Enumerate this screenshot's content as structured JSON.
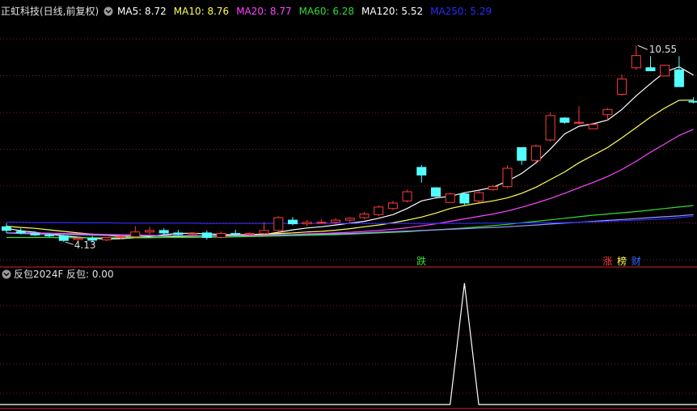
{
  "header": {
    "stock_title": "正虹科技(日线,前复权)",
    "indicator_title": "反包2024F",
    "indicator_value": "反包: 0.00"
  },
  "colors": {
    "background": "#000000",
    "grid": "#8b1a1a",
    "up_candle": "#ff3c3c",
    "down_candle": "#54ffff",
    "axis_line": "#8b1a1a"
  },
  "chart_data": [
    {
      "type": "candlestick",
      "title": "正虹科技(日线,前复权)",
      "ylim": [
        3.6,
        11.3
      ],
      "price_labels": {
        "high": "10.55",
        "low": "4.13"
      },
      "ma_legend": [
        {
          "name": "MA5",
          "label": "MA5: 8.72",
          "color": "#ffffff"
        },
        {
          "name": "MA10",
          "label": "MA10: 8.76",
          "color": "#ffff55"
        },
        {
          "name": "MA20",
          "label": "MA20: 8.77",
          "color": "#ff44ff"
        },
        {
          "name": "MA60",
          "label": "MA60: 6.28",
          "color": "#33dd33"
        },
        {
          "name": "MA120",
          "label": "MA120: 5.52",
          "color": "#ffffff"
        },
        {
          "name": "MA250",
          "label": "MA250: 5.29",
          "color": "#2a2aff"
        }
      ],
      "ohlc": [
        [
          4.6,
          4.72,
          4.4,
          4.48
        ],
        [
          4.45,
          4.55,
          4.35,
          4.4
        ],
        [
          4.38,
          4.45,
          4.3,
          4.33
        ],
        [
          4.33,
          4.4,
          4.26,
          4.3
        ],
        [
          4.3,
          4.33,
          4.1,
          4.15
        ],
        [
          4.18,
          4.26,
          4.13,
          4.22
        ],
        [
          4.22,
          4.3,
          4.13,
          4.16
        ],
        [
          4.17,
          4.27,
          4.13,
          4.25
        ],
        [
          4.25,
          4.35,
          4.2,
          4.28
        ],
        [
          4.28,
          4.62,
          4.25,
          4.43
        ],
        [
          4.43,
          4.6,
          4.35,
          4.48
        ],
        [
          4.48,
          4.55,
          4.35,
          4.4
        ],
        [
          4.4,
          4.5,
          4.32,
          4.35
        ],
        [
          4.35,
          4.42,
          4.3,
          4.38
        ],
        [
          4.4,
          4.48,
          4.18,
          4.25
        ],
        [
          4.25,
          4.45,
          4.22,
          4.38
        ],
        [
          4.38,
          4.5,
          4.3,
          4.35
        ],
        [
          4.35,
          4.42,
          4.3,
          4.38
        ],
        [
          4.38,
          4.75,
          4.35,
          4.48
        ],
        [
          4.48,
          4.95,
          4.45,
          4.9
        ],
        [
          4.82,
          4.92,
          4.65,
          4.7
        ],
        [
          4.7,
          4.82,
          4.62,
          4.75
        ],
        [
          4.75,
          4.85,
          4.7,
          4.75
        ],
        [
          4.75,
          4.88,
          4.7,
          4.82
        ],
        [
          4.82,
          4.92,
          4.75,
          4.88
        ],
        [
          4.9,
          5.08,
          4.85,
          5.02
        ],
        [
          5.0,
          5.3,
          4.95,
          5.25
        ],
        [
          5.2,
          5.45,
          5.15,
          5.38
        ],
        [
          5.45,
          5.82,
          5.4,
          5.75
        ],
        [
          6.55,
          6.63,
          6.05,
          6.3
        ],
        [
          5.88,
          5.9,
          5.57,
          5.6
        ],
        [
          5.4,
          5.72,
          5.4,
          5.68
        ],
        [
          5.68,
          5.71,
          5.3,
          5.38
        ],
        [
          5.45,
          5.78,
          5.4,
          5.72
        ],
        [
          5.82,
          5.98,
          5.78,
          5.92
        ],
        [
          5.92,
          6.62,
          5.88,
          6.52
        ],
        [
          7.2,
          7.2,
          6.63,
          6.78
        ],
        [
          6.78,
          7.3,
          6.72,
          7.25
        ],
        [
          7.45,
          8.35,
          7.4,
          8.25
        ],
        [
          8.17,
          8.2,
          7.98,
          8.03
        ],
        [
          8.0,
          8.56,
          7.95,
          8.03
        ],
        [
          7.82,
          8.02,
          7.82,
          7.96
        ],
        [
          8.28,
          8.5,
          8.1,
          8.45
        ],
        [
          8.95,
          9.6,
          8.9,
          9.45
        ],
        [
          9.82,
          10.55,
          9.75,
          10.22
        ],
        [
          9.82,
          10.2,
          9.8,
          9.72
        ],
        [
          9.55,
          9.92,
          9.55,
          9.9
        ],
        [
          9.75,
          10.2,
          9.2,
          9.2
        ],
        [
          8.72,
          8.85,
          8.65,
          8.7
        ]
      ],
      "ma": {
        "MA5": [
          4.55,
          4.47,
          4.42,
          4.36,
          4.3,
          4.26,
          4.22,
          4.2,
          4.21,
          4.24,
          4.28,
          4.34,
          4.38,
          4.39,
          4.37,
          4.35,
          4.34,
          4.33,
          4.35,
          4.42,
          4.5,
          4.56,
          4.6,
          4.66,
          4.72,
          4.78,
          4.88,
          5.0,
          5.2,
          5.45,
          5.55,
          5.6,
          5.72,
          5.8,
          5.9,
          6.1,
          6.35,
          6.7,
          7.15,
          7.65,
          7.9,
          7.98,
          8.1,
          8.45,
          8.9,
          9.3,
          9.68,
          9.85,
          9.58
        ],
        "MA10": [
          4.62,
          4.58,
          4.55,
          4.5,
          4.45,
          4.4,
          4.36,
          4.32,
          4.28,
          4.25,
          4.25,
          4.26,
          4.28,
          4.29,
          4.31,
          4.32,
          4.34,
          4.35,
          4.36,
          4.38,
          4.4,
          4.43,
          4.45,
          4.49,
          4.54,
          4.6,
          4.66,
          4.73,
          4.82,
          4.92,
          5.05,
          5.2,
          5.3,
          5.38,
          5.45,
          5.55,
          5.7,
          5.9,
          6.15,
          6.4,
          6.7,
          6.95,
          7.2,
          7.52,
          7.86,
          8.2,
          8.5,
          8.75,
          8.76
        ],
        "MA20": [
          4.4,
          4.4,
          4.4,
          4.39,
          4.38,
          4.37,
          4.36,
          4.35,
          4.34,
          4.33,
          4.32,
          4.31,
          4.31,
          4.31,
          4.31,
          4.31,
          4.31,
          4.32,
          4.33,
          4.34,
          4.35,
          4.37,
          4.38,
          4.4,
          4.42,
          4.45,
          4.48,
          4.52,
          4.57,
          4.63,
          4.7,
          4.78,
          4.86,
          4.94,
          5.02,
          5.12,
          5.24,
          5.38,
          5.53,
          5.7,
          5.88,
          6.06,
          6.25,
          6.48,
          6.75,
          7.05,
          7.32,
          7.6,
          7.8
        ],
        "MA60": [
          4.25,
          4.25,
          4.25,
          4.25,
          4.24,
          4.24,
          4.24,
          4.24,
          4.24,
          4.24,
          4.24,
          4.25,
          4.25,
          4.25,
          4.26,
          4.26,
          4.27,
          4.28,
          4.29,
          4.3,
          4.31,
          4.32,
          4.33,
          4.34,
          4.36,
          4.38,
          4.4,
          4.42,
          4.44,
          4.47,
          4.5,
          4.53,
          4.56,
          4.6,
          4.64,
          4.68,
          4.73,
          4.78,
          4.83,
          4.88,
          4.93,
          4.98,
          5.02,
          5.06,
          5.1,
          5.15,
          5.2,
          5.25,
          5.3
        ],
        "MA120": [
          4.4,
          4.38,
          4.37,
          4.36,
          4.35,
          4.34,
          4.33,
          4.32,
          4.31,
          4.3,
          4.3,
          4.3,
          4.3,
          4.3,
          4.3,
          4.3,
          4.3,
          4.31,
          4.32,
          4.33,
          4.34,
          4.35,
          4.36,
          4.37,
          4.38,
          4.4,
          4.42,
          4.44,
          4.46,
          4.48,
          4.5,
          4.52,
          4.54,
          4.56,
          4.58,
          4.6,
          4.63,
          4.66,
          4.69,
          4.72,
          4.75,
          4.78,
          4.81,
          4.84,
          4.87,
          4.9,
          4.93,
          4.96,
          5.0
        ],
        "MA250": [
          4.75,
          4.75,
          4.74,
          4.74,
          4.74,
          4.73,
          4.73,
          4.73,
          4.72,
          4.72,
          4.72,
          4.72,
          4.72,
          4.72,
          4.71,
          4.71,
          4.71,
          4.71,
          4.71,
          4.71,
          4.71,
          4.71,
          4.71,
          4.71,
          4.71,
          4.71,
          4.71,
          4.71,
          4.71,
          4.71,
          4.71,
          4.71,
          4.71,
          4.72,
          4.72,
          4.72,
          4.72,
          4.73,
          4.73,
          4.74,
          4.75,
          4.76,
          4.78,
          4.8,
          4.82,
          4.84,
          4.86,
          4.9,
          4.95
        ]
      },
      "markers": [
        {
          "text": "跌",
          "index": 29,
          "color": "#33dd33"
        },
        {
          "text": "涨",
          "index": 42,
          "color": "#ff3c3c"
        },
        {
          "text": "榜",
          "index": 43,
          "color": "#ffff55"
        },
        {
          "text": "财",
          "index": 44,
          "color": "#2a6aff"
        }
      ]
    },
    {
      "type": "line",
      "title": "反包2024F",
      "series": [
        {
          "name": "反包",
          "color": "#ffffff",
          "values": [
            0,
            0,
            0,
            0,
            0,
            0,
            0,
            0,
            0,
            0,
            0,
            0,
            0,
            0,
            0,
            0,
            0,
            0,
            0,
            0,
            0,
            0,
            0,
            0,
            0,
            0,
            0,
            0,
            0,
            0,
            0,
            0,
            1,
            0,
            0,
            0,
            0,
            0,
            0,
            0,
            0,
            0,
            0,
            0,
            0,
            0,
            0,
            0,
            0
          ]
        }
      ],
      "ylim": [
        0,
        1
      ]
    }
  ]
}
